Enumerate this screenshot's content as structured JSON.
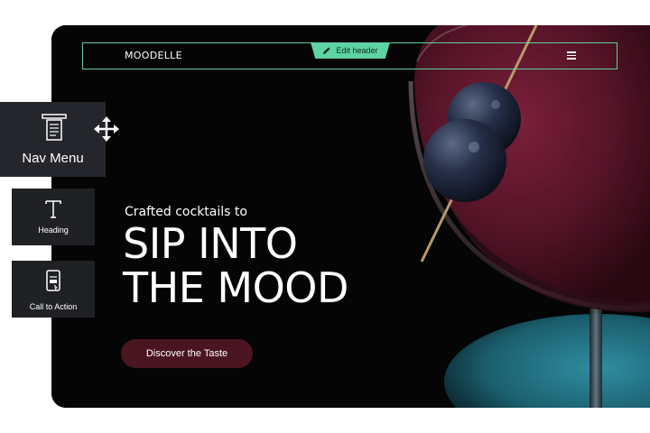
{
  "header": {
    "brand": "MOODELLE",
    "edit_label": "Edit header",
    "menu_icon": "hamburger-icon",
    "accent_color": "#5ed3a3"
  },
  "hero": {
    "kicker": "Crafted cocktails to",
    "headline_line1": "SIP INTO",
    "headline_line2": "THE MOOD",
    "cta_label": "Discover the Taste",
    "cta_color": "#4a1420"
  },
  "widgets": {
    "nav_menu": {
      "label": "Nav Menu",
      "icon": "nav-menu-icon"
    },
    "heading": {
      "label": "Heading",
      "icon": "text-t-icon"
    },
    "call_to_action": {
      "label": "Call to Action",
      "icon": "call-to-action-icon"
    },
    "drag_icon": "move-arrows-icon"
  }
}
